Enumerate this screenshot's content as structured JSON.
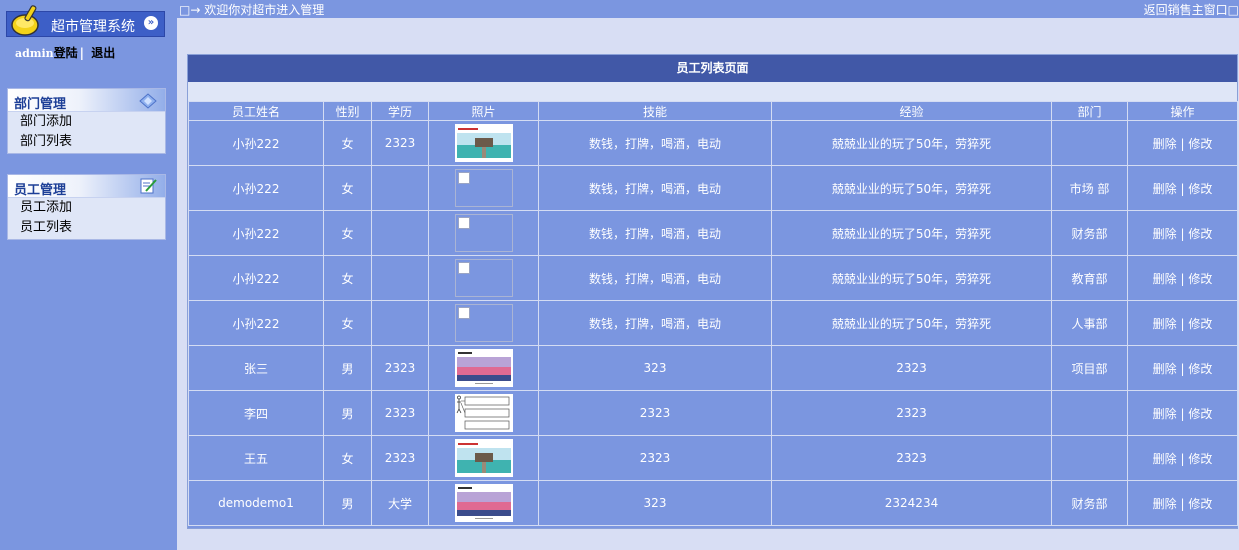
{
  "sidebar": {
    "app_title": "超市管理系统",
    "user": "admin",
    "login_text": "登陆",
    "logout_label": "退出",
    "sections": [
      {
        "title": "部门管理",
        "icon": "folder-icon",
        "items": [
          "部门添加",
          "部门列表"
        ]
      },
      {
        "title": "员工管理",
        "icon": "edit-icon",
        "items": [
          "员工添加",
          "员工列表"
        ]
      }
    ]
  },
  "topbar": {
    "welcome": "□→ 欢迎你对超市进入管理",
    "back_label": "返回销售主窗口□"
  },
  "table": {
    "title": "员工列表页面",
    "headers": [
      "员工姓名",
      "性别",
      "学历",
      "照片",
      "技能",
      "经验",
      "部门",
      "操作"
    ],
    "delete_label": "删除",
    "action_sep": "|",
    "edit_label": "修改",
    "rows": [
      {
        "name": "小孙222",
        "gender": "女",
        "edu": "2323",
        "photo": "seaside-pier-photo",
        "skills": "数钱，打牌，喝酒，电动",
        "experience": "兢兢业业的玩了50年，劳猝死",
        "dept": ""
      },
      {
        "name": "小孙222",
        "gender": "女",
        "edu": "",
        "photo": "broken-image",
        "skills": "数钱，打牌，喝酒，电动",
        "experience": "兢兢业业的玩了50年，劳猝死",
        "dept": "市场 部"
      },
      {
        "name": "小孙222",
        "gender": "女",
        "edu": "",
        "photo": "broken-image",
        "skills": "数钱，打牌，喝酒，电动",
        "experience": "兢兢业业的玩了50年，劳猝死",
        "dept": "财务部"
      },
      {
        "name": "小孙222",
        "gender": "女",
        "edu": "",
        "photo": "broken-image",
        "skills": "数钱，打牌，喝酒，电动",
        "experience": "兢兢业业的玩了50年，劳猝死",
        "dept": "教育部"
      },
      {
        "name": "小孙222",
        "gender": "女",
        "edu": "",
        "photo": "broken-image",
        "skills": "数钱，打牌，喝酒，电动",
        "experience": "兢兢业业的玩了50年，劳猝死",
        "dept": "人事部"
      },
      {
        "name": "张三",
        "gender": "男",
        "edu": "2323",
        "photo": "sunset-coast-photo",
        "skills": "323",
        "experience": "2323",
        "dept": "项目部"
      },
      {
        "name": "李四",
        "gender": "男",
        "edu": "2323",
        "photo": "flowchart-thumbnail",
        "skills": "2323",
        "experience": "2323",
        "dept": ""
      },
      {
        "name": "王五",
        "gender": "女",
        "edu": "2323",
        "photo": "seaside-pier-photo",
        "skills": "2323",
        "experience": "2323",
        "dept": ""
      },
      {
        "name": "demodemo1",
        "gender": "男",
        "edu": "大学",
        "photo": "sunset-coast-photo",
        "skills": "323",
        "experience": "2324234",
        "dept": "财务部"
      }
    ]
  },
  "colors": {
    "background": "#7b96e0",
    "content": "#d8def4",
    "header": "#4158a7",
    "sidebar_title": "#1d3f97"
  }
}
